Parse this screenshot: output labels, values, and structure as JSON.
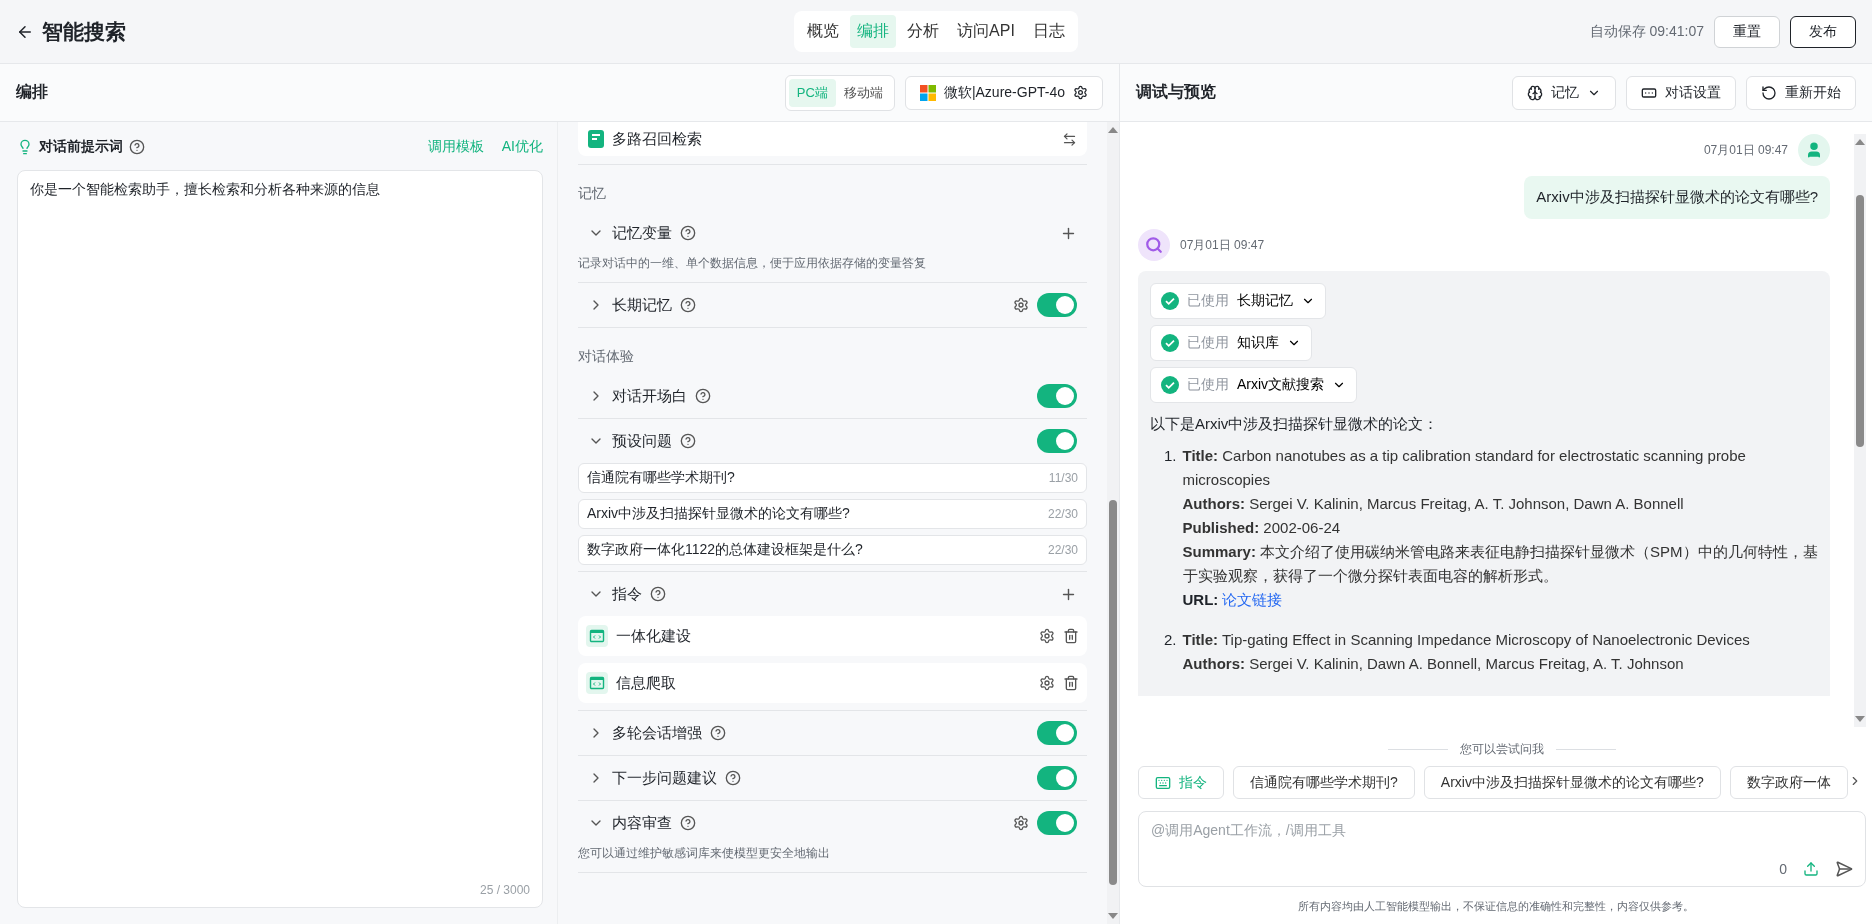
{
  "header": {
    "title": "智能搜索",
    "tabs": [
      {
        "label": "概览",
        "selected": false
      },
      {
        "label": "编排",
        "selected": true
      },
      {
        "label": "分析",
        "selected": false
      },
      {
        "label": "访问API",
        "selected": false
      },
      {
        "label": "日志",
        "selected": false
      }
    ],
    "autosave": "自动保存 09:41:07",
    "buttons": [
      {
        "label": "重置",
        "kind": "secondary"
      },
      {
        "label": "发布",
        "kind": "primary"
      }
    ]
  },
  "editor": {
    "title": "编排",
    "platforms": [
      {
        "label": "PC端",
        "selected": true
      },
      {
        "label": "移动端",
        "selected": false
      }
    ],
    "model": "微软|Azure-GPT-4o"
  },
  "prompt": {
    "title": "对话前提示词",
    "actions": [
      "调用模板",
      "AI优化"
    ],
    "value": "你是一个智能检索助手，擅长检索和分析各种来源的信息",
    "count": "25 / 3000"
  },
  "config": {
    "top_item": "多路召回检索",
    "items": [
      {
        "kind": "heading",
        "label": "记忆"
      },
      {
        "kind": "row",
        "label": "记忆变量",
        "expanded": true,
        "add": true
      },
      {
        "kind": "description",
        "label": "记录对话中的一维、单个数据信息，便于应用依据存储的变量答复"
      },
      {
        "kind": "row",
        "label": "长期记忆",
        "expanded": false,
        "settings": true,
        "on": true
      },
      {
        "kind": "heading",
        "label": "对话体验"
      },
      {
        "kind": "row",
        "label": "对话开场白",
        "expanded": false,
        "on": true
      },
      {
        "kind": "row",
        "label": "预设问题",
        "expanded": true,
        "on": true
      },
      {
        "kind": "question",
        "label": "信通院有哪些学术期刊?",
        "count": "11/30"
      },
      {
        "kind": "question",
        "label": "Arxiv中涉及扫描探针显微术的论文有哪些?",
        "count": "22/30"
      },
      {
        "kind": "question",
        "label": "数字政府一体化1122的总体建设框架是什么?",
        "count": "22/30"
      },
      {
        "kind": "row",
        "label": "指令",
        "expanded": true,
        "add": true
      },
      {
        "kind": "tool",
        "label": "一体化建设"
      },
      {
        "kind": "tool",
        "label": "信息爬取"
      },
      {
        "kind": "row",
        "label": "多轮会话增强",
        "expanded": false,
        "on": true
      },
      {
        "kind": "row",
        "label": "下一步问题建议",
        "expanded": false,
        "on": true
      },
      {
        "kind": "row",
        "label": "内容审查",
        "expanded": true,
        "settings": true,
        "on": true
      },
      {
        "kind": "description",
        "label": "您可以通过维护敏感词库来使模型更安全地输出"
      }
    ]
  },
  "preview": {
    "title": "调试与预览",
    "buttons": [
      {
        "label": "记忆",
        "kind": "memory"
      },
      {
        "label": "对话设置",
        "kind": "settings"
      },
      {
        "label": "重新开始",
        "kind": "restart"
      }
    ]
  },
  "chat": {
    "messages": [
      {
        "kind": "user",
        "time": "07月01日 09:47",
        "text": "Arxiv中涉及扫描探针显微术的论文有哪些?"
      },
      {
        "kind": "bot",
        "time": "07月01日 09:47",
        "tools": [
          {
            "status": "已使用",
            "name": "长期记忆"
          },
          {
            "status": "已使用",
            "name": "知识库"
          },
          {
            "status": "已使用",
            "name": "Arxiv文献搜索"
          }
        ],
        "intro": "以下是Arxiv中涉及扫描探针显微术的论文：",
        "papers": [
          {
            "number": "1.",
            "fields": [
              {
                "kind": "text",
                "text": "**Title:** Carbon nanotubes as a tip calibration standard for electrostatic scanning probe microscopies"
              },
              {
                "kind": "text",
                "text": "**Authors:** Sergei V. Kalinin, Marcus Freitag, A. T. Johnson, Dawn A. Bonnell"
              },
              {
                "kind": "text",
                "text": "**Published:** 2002-06-24"
              },
              {
                "kind": "text",
                "text": "**Summary:** 本文介绍了使用碳纳米管电路来表征电静扫描探针显微术（SPM）中的几何特性，基于实验观察，获得了一个微分探针表面电容的解析形式。"
              },
              {
                "kind": "link",
                "label": "URL:",
                "text": "论文链接"
              }
            ]
          },
          {
            "number": "2.",
            "fields": [
              {
                "kind": "text",
                "text": "**Title:** Tip-gating Effect in Scanning Impedance Microscopy of Nanoelectronic Devices"
              },
              {
                "kind": "text",
                "text": "**Authors:** Sergei V. Kalinin, Dawn A. Bonnell, Marcus Freitag, A. T. Johnson"
              }
            ]
          }
        ]
      }
    ]
  },
  "suggestions": {
    "title": "您可以尝试问我",
    "command": "指令",
    "items": [
      "信通院有哪些学术期刊?",
      "Arxiv中涉及扫描探针显微术的论文有哪些?",
      "数字政府一体"
    ]
  },
  "composer": {
    "placeholder": "@调用Agent工作流，/调用工具",
    "count": "0"
  },
  "footer": "所有内容均由人工智能模型输出，不保证信息的准确性和完整性，内容仅供参考。"
}
